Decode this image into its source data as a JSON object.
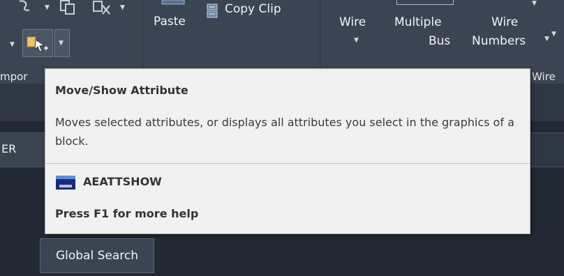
{
  "ribbon": {
    "clipboard": {
      "paste_label": "Paste",
      "copy_clip_label": "Copy Clip"
    },
    "insert_wires": {
      "wire_label": "Wire",
      "multiple_bus_line1": "Multiple",
      "multiple_bus_line2": "Bus",
      "wire_numbers_line1": "Wire",
      "wire_numbers_line2": "Numbers",
      "panel_label_partial": "Wire"
    },
    "components_panel_label_partial": "mpor",
    "dropdown_glyph": "▼"
  },
  "left_panel": {
    "label_partial": "ER"
  },
  "search": {
    "button_label": "Global Search"
  },
  "tooltip": {
    "title": "Move/Show Attribute",
    "description": "Moves selected attributes, or displays all attributes you select in the graphics of a block.",
    "command": "AEATTSHOW",
    "help": "Press F1 for more help"
  },
  "icons": {
    "components": [
      "insert-component-icon",
      "copy-component-icon",
      "delete-component-icon",
      "move-show-attribute-icon"
    ],
    "copy_clip": "copy-clip-icon",
    "command": "command-window-icon"
  },
  "colors": {
    "ribbon_bg": "#3b4453",
    "app_bg": "#222933",
    "tooltip_bg": "#f1f1f1",
    "tooltip_text": "#333333"
  }
}
